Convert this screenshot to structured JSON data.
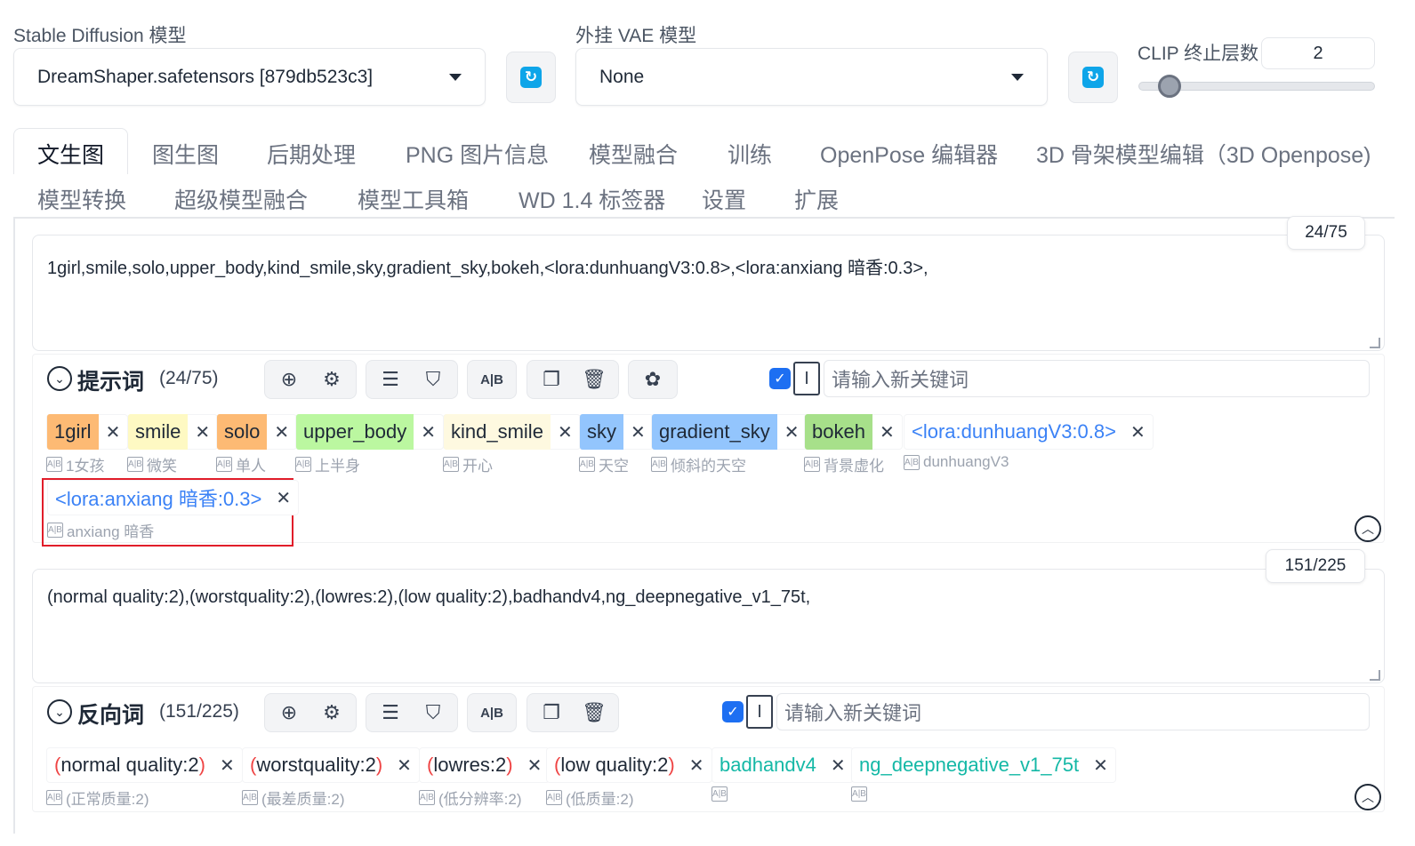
{
  "models": {
    "sd_label": "Stable Diffusion 模型",
    "sd_value": "DreamShaper.safetensors [879db523c3]",
    "vae_label": "外挂 VAE 模型",
    "vae_value": "None",
    "clip_label": "CLIP 终止层数",
    "clip_value": "2",
    "clip_slider_fraction": 0.08
  },
  "tabs": {
    "row1": [
      "文生图",
      "图生图",
      "后期处理",
      "PNG 图片信息",
      "模型融合",
      "训练",
      "OpenPose 编辑器",
      "3D 骨架模型编辑（3D Openpose)"
    ],
    "row2": [
      "模型转换",
      "超级模型融合",
      "模型工具箱",
      "WD 1.4 标签器",
      "设置",
      "扩展"
    ],
    "active": "文生图"
  },
  "positive": {
    "counter": "24/75",
    "text": "1girl,smile,solo,upper_body,kind_smile,sky,gradient_sky,bokeh,<lora:dunhuangV3:0.8>,<lora:anxiang 暗香:0.3>,",
    "title": "提示词",
    "count": "(24/75)",
    "keyword_placeholder": "请输入新关键词",
    "tags": [
      {
        "text": "1girl",
        "trans": "1女孩"
      },
      {
        "text": "smile",
        "trans": "微笑"
      },
      {
        "text": "solo",
        "trans": "单人"
      },
      {
        "text": "upper_body",
        "trans": "上半身"
      },
      {
        "text": "kind_smile",
        "trans": "开心"
      },
      {
        "text": "sky",
        "trans": "天空"
      },
      {
        "text": "gradient_sky",
        "trans": "倾斜的天空"
      },
      {
        "text": "bokeh",
        "trans": "背景虚化"
      },
      {
        "text": "<lora:dunhuangV3:0.8>",
        "trans": "dunhuangV3"
      },
      {
        "text": "<lora:anxiang 暗香:0.3>",
        "trans": "anxiang 暗香"
      }
    ]
  },
  "negative": {
    "counter": "151/225",
    "text": "(normal quality:2),(worstquality:2),(lowres:2),(low quality:2),badhandv4,ng_deepnegative_v1_75t,",
    "title": "反向词",
    "count": "(151/225)",
    "keyword_placeholder": "请输入新关键词",
    "tags": [
      {
        "inner": "normal quality:2",
        "trans": "(正常质量:2)"
      },
      {
        "inner": "worstquality:2",
        "trans": "(最差质量:2)"
      },
      {
        "inner": "lowres:2",
        "trans": "(低分辨率:2)"
      },
      {
        "inner": "low quality:2",
        "trans": "(低质量:2)"
      },
      {
        "text": "badhandv4",
        "trans": ""
      },
      {
        "text": "ng_deepnegative_v1_75t",
        "trans": ""
      }
    ]
  },
  "icons": {
    "refresh": "refresh-icon",
    "globe": "globe-icon",
    "gear": "gear-icon",
    "history": "history-icon",
    "bookmark": "bookmark-icon",
    "translate": "translate-icon",
    "copy": "copy-icon",
    "trash": "trash-icon",
    "openai": "openai-icon"
  },
  "colors": {
    "accent_blue": "#1d6ff2",
    "highlight_red": "#e11d2a",
    "refresh_blue": "#0ea5e9"
  }
}
